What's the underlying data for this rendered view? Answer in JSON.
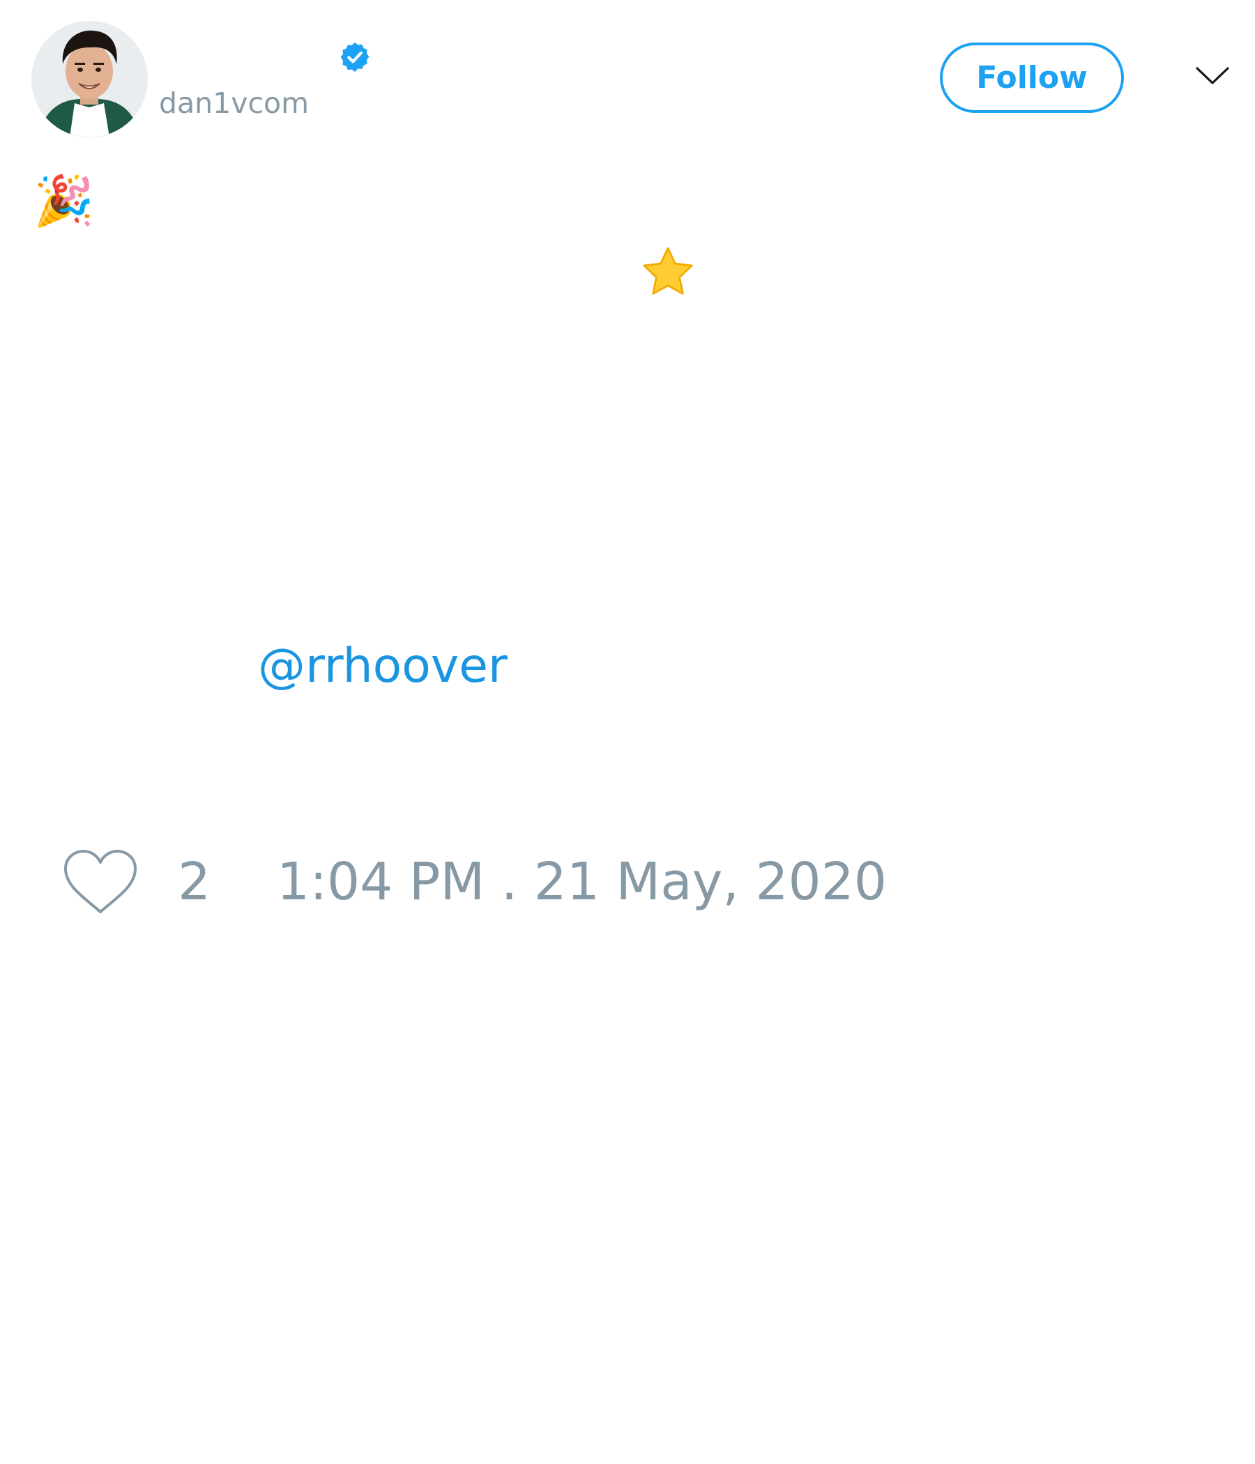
{
  "author": {
    "handle": "dan1vcom",
    "avatar": "profile-photo",
    "verified_icon": "verified-badge-icon",
    "badge_color": "#1da1f2"
  },
  "actions": {
    "follow_label": "Follow",
    "menu_icon": "chevron-down-icon"
  },
  "body": {
    "emoji_1": "🎉",
    "emoji_2": "star-emoji",
    "mention": "@rrhoover",
    "mention_color": "#1b95e0"
  },
  "footer": {
    "like_icon": "heart-icon",
    "like_count": "2",
    "timestamp": "1:04 PM . 21 May, 2020",
    "muted_color": "#8899a6"
  }
}
